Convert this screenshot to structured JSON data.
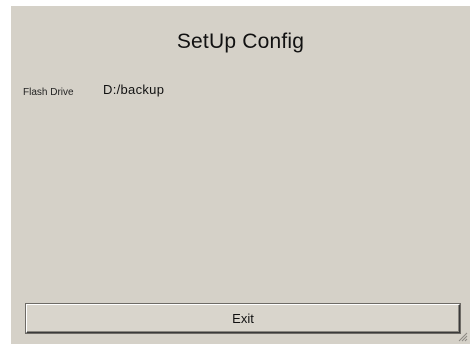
{
  "window": {
    "title": "SetUp Config"
  },
  "settings": {
    "flash_drive_label": "Flash Drive",
    "flash_drive_value": "D:/backup"
  },
  "actions": {
    "exit_label": "Exit"
  },
  "icons": {
    "resize": "resize-grip-icon"
  },
  "colors": {
    "window_background": "#d5d1c8",
    "text": "#111111"
  }
}
